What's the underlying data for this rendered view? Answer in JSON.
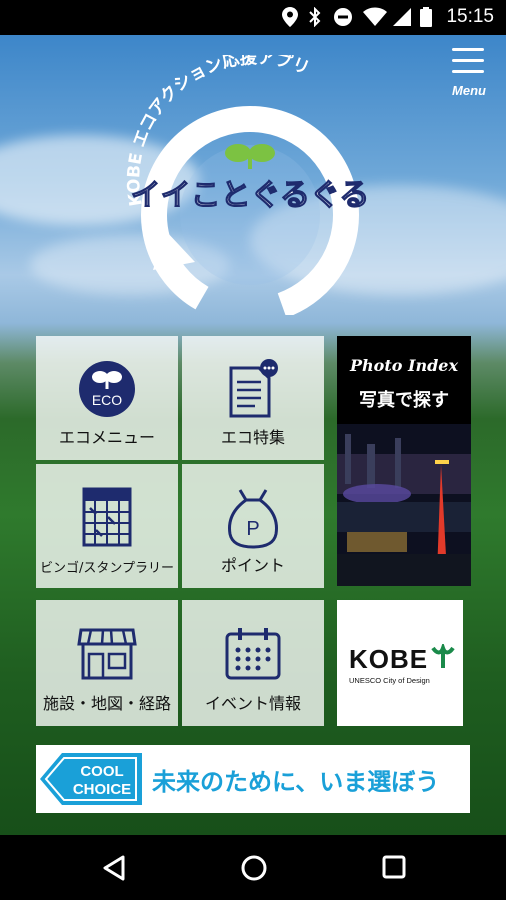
{
  "status_bar": {
    "time": "15:15"
  },
  "header": {
    "menu_label": "Menu"
  },
  "logo": {
    "arc_text": "KOBE エコアクション応援アプリ",
    "title": "イイことぐるぐる"
  },
  "tiles": [
    {
      "label": "エコメニュー",
      "icon": "eco-badge-icon",
      "badge": "ECO"
    },
    {
      "label": "エコ特集",
      "icon": "document-chat-icon"
    },
    {
      "label": "ビンゴ/スタンプラリー",
      "icon": "bingo-card-icon"
    },
    {
      "label": "ポイント",
      "icon": "money-bag-icon",
      "badge": "P"
    },
    {
      "label": "施設・地図・経路",
      "icon": "shop-icon"
    },
    {
      "label": "イベント情報",
      "icon": "calendar-icon"
    }
  ],
  "photo_index": {
    "title_en": "Photo Index",
    "title_ja": "写真で探す"
  },
  "kobe_logo": {
    "name": "KOBE",
    "tagline": "UNESCO City of Design"
  },
  "banner": {
    "badge_line1": "COOL",
    "badge_line2": "CHOICE",
    "text": "未来のために、いま選ぼう"
  },
  "colors": {
    "accent_navy": "#1e2b6e",
    "banner_blue": "#1aa0d8",
    "sprout_green": "#7cc242"
  }
}
